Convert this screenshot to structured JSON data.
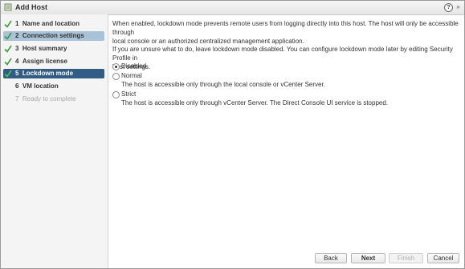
{
  "window": {
    "title": "Add Host",
    "help_icon": "help-icon",
    "expand_icon": "expand-icon"
  },
  "steps": [
    {
      "number": "1",
      "label": "Name and location",
      "complete": true
    },
    {
      "number": "2",
      "label": "Connection settings",
      "complete": true
    },
    {
      "number": "3",
      "label": "Host summary",
      "complete": true
    },
    {
      "number": "4",
      "label": "Assign license",
      "complete": true
    },
    {
      "number": "5",
      "label": "Lockdown mode",
      "complete": true
    },
    {
      "number": "6",
      "label": "VM location",
      "complete": false
    },
    {
      "number": "7",
      "label": "Ready to complete",
      "complete": false
    }
  ],
  "content": {
    "intro_line1": "When enabled, lockdown mode prevents remote users from logging directly into this host. The host will only be accessible through",
    "intro_line2": "local console or an authorized centralized management application.",
    "hint_line1": "If you are unsure what to do, leave lockdown mode disabled. You can configure lockdown mode later by editing Security Profile in",
    "hint_line2": "host settings.",
    "options": [
      {
        "label": "Disabled",
        "description": "",
        "checked": true
      },
      {
        "label": "Normal",
        "description": "The host is accessible only through the local console or vCenter Server.",
        "checked": false
      },
      {
        "label": "Strict",
        "description": "The host is accessible only through vCenter Server. The Direct Console UI service is stopped.",
        "checked": false
      }
    ]
  },
  "footer": {
    "back": "Back",
    "next": "Next",
    "finish": "Finish",
    "cancel": "Cancel"
  },
  "colors": {
    "current_step_bg": "#315c86",
    "selected_step_bg": "#a9c2d7",
    "check_green": "#3b9a3b"
  }
}
